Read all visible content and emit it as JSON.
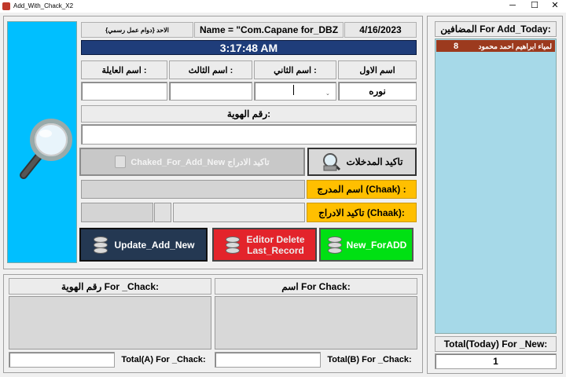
{
  "window": {
    "title": "Add_With_Chack_X2",
    "minimize": "─",
    "maximize": "☐",
    "close": "✕"
  },
  "header": {
    "day_label": "الاحد {دوام عمل رسمي}",
    "name_label": "Name = \"Com.Capane for_DBZ",
    "date": "4/16/2023",
    "time": "3:17:48 AM"
  },
  "name_fields": {
    "family_label": "اسم العايلة :",
    "third_label": "اسم الثالث :",
    "second_label": "اسم الثاني :",
    "first_label": "اسم الاول",
    "first_value": "نوره",
    "second_value": "",
    "third_value": "",
    "family_value": ""
  },
  "id_field": {
    "label": "رقم الهوية:",
    "value": ""
  },
  "actions": {
    "checked_for_add_new": "Chaked_For_Add_New تاكيد الادراج",
    "confirm_entries": "تاكيد المدخلات"
  },
  "chaak": {
    "included_name_label": "اسم المدرج (Chaak) :",
    "confirm_insert_label": "تاكيد الادراج (Chaak):"
  },
  "bottom_buttons": {
    "update_add_new": "Update_Add_New",
    "editor_delete_line1": "Editor Delete",
    "editor_delete_line2": "Last_Record",
    "new_for_add": "New_ForADD"
  },
  "check_section": {
    "id_header": "رقم الهوية For _Chack:",
    "name_header": "اسم For Chack:",
    "total_a_label": "Total(A) For _Chack:",
    "total_b_label": "Total(B) For _Chack:"
  },
  "today_panel": {
    "header": "المضافين For Add_Today:",
    "items": [
      {
        "count": "8",
        "name": "لمياء ابراهيم احمد محمود"
      }
    ],
    "total_label": "Total(Today) For _New:",
    "total_value": "1"
  },
  "colors": {
    "title_time_bg": "#1f3d7a",
    "left_panel_bg": "#00bfff",
    "list_bg": "#a6d9e8",
    "selected_row": "#9c3a1e",
    "chaak_label_bg": "#ffbf00",
    "update_btn": "#243852",
    "delete_btn": "#e3242b",
    "new_btn": "#00e013"
  }
}
